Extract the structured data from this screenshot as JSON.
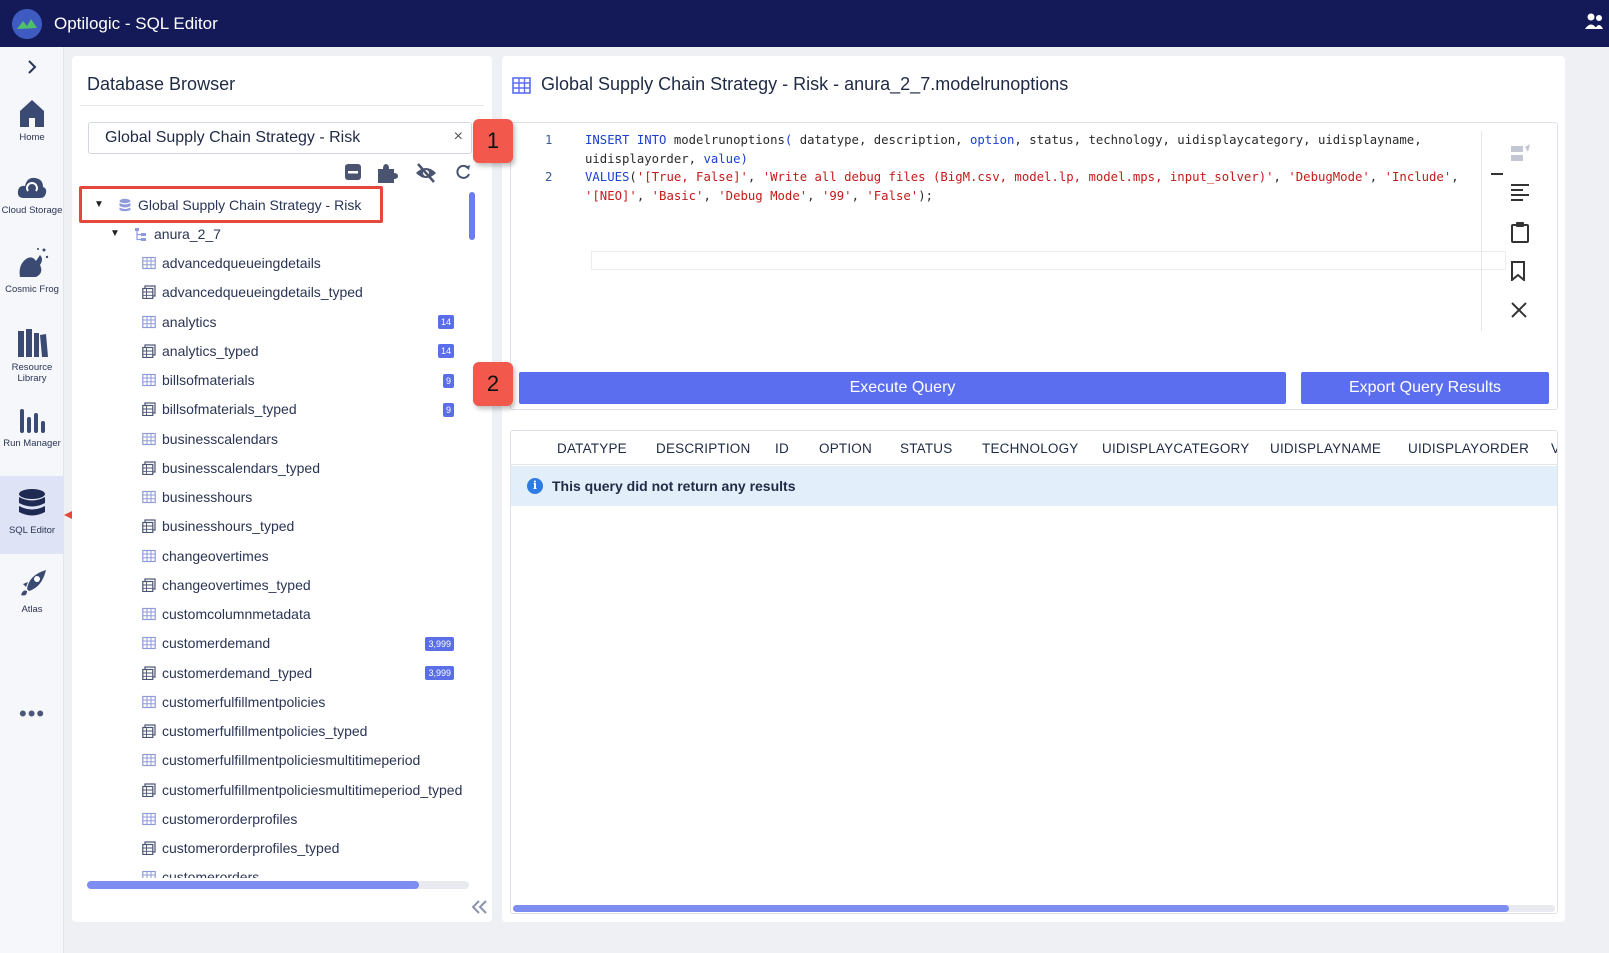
{
  "app": {
    "title": "Optilogic - SQL Editor"
  },
  "rail": {
    "items": [
      {
        "label": "Home",
        "icon": "home-icon"
      },
      {
        "label": "Cloud Storage",
        "icon": "cloud-storage-icon"
      },
      {
        "label": "Cosmic Frog",
        "icon": "cosmic-frog-icon"
      },
      {
        "label": "Resource Library",
        "icon": "resource-library-icon"
      },
      {
        "label": "Run Manager",
        "icon": "run-manager-icon"
      },
      {
        "label": "SQL Editor",
        "icon": "sql-editor-icon",
        "active": true
      },
      {
        "label": "Atlas",
        "icon": "atlas-icon"
      }
    ],
    "more": "•••"
  },
  "browser": {
    "title": "Database Browser",
    "db_select_value": "Global Supply Chain Strategy - Risk",
    "clear": "×",
    "tree": [
      {
        "label": "Global Supply Chain Strategy - Risk",
        "type": "database"
      },
      {
        "label": "anura_2_7",
        "type": "schema"
      },
      {
        "label": "advancedqueueingdetails",
        "type": "table",
        "badge": ""
      },
      {
        "label": "advancedqueueingdetails_typed",
        "type": "view",
        "badge": ""
      },
      {
        "label": "analytics",
        "type": "table",
        "badge": "14"
      },
      {
        "label": "analytics_typed",
        "type": "view",
        "badge": "14"
      },
      {
        "label": "billsofmaterials",
        "type": "table",
        "badge": "9"
      },
      {
        "label": "billsofmaterials_typed",
        "type": "view",
        "badge": "9"
      },
      {
        "label": "businesscalendars",
        "type": "table",
        "badge": ""
      },
      {
        "label": "businesscalendars_typed",
        "type": "view",
        "badge": ""
      },
      {
        "label": "businesshours",
        "type": "table",
        "badge": ""
      },
      {
        "label": "businesshours_typed",
        "type": "view",
        "badge": ""
      },
      {
        "label": "changeovertimes",
        "type": "table",
        "badge": ""
      },
      {
        "label": "changeovertimes_typed",
        "type": "view",
        "badge": ""
      },
      {
        "label": "customcolumnmetadata",
        "type": "table",
        "badge": ""
      },
      {
        "label": "customerdemand",
        "type": "table",
        "badge": "3,999"
      },
      {
        "label": "customerdemand_typed",
        "type": "view",
        "badge": "3,999"
      },
      {
        "label": "customerfulfillmentpolicies",
        "type": "table",
        "badge": ""
      },
      {
        "label": "customerfulfillmentpolicies_typed",
        "type": "view",
        "badge": ""
      },
      {
        "label": "customerfulfillmentpoliciesmultitimeperiod",
        "type": "table",
        "badge": ""
      },
      {
        "label": "customerfulfillmentpoliciesmultitimeperiod_typed",
        "type": "view",
        "badge": ""
      },
      {
        "label": "customerorderprofiles",
        "type": "table",
        "badge": ""
      },
      {
        "label": "customerorderprofiles_typed",
        "type": "view",
        "badge": ""
      },
      {
        "label": "customerorders",
        "type": "table",
        "badge": ""
      }
    ]
  },
  "editor": {
    "title": "Global Supply Chain Strategy - Risk - anura_2_7.modelrunoptions",
    "line_numbers": [
      "1",
      "2"
    ],
    "code_lines": [
      [
        {
          "t": "INSERT INTO",
          "c": "kw"
        },
        {
          "t": " modelrunoptions",
          "c": ""
        },
        {
          "t": "(",
          "c": "kw"
        },
        {
          "t": " datatype, description, ",
          "c": ""
        },
        {
          "t": "option",
          "c": "kw"
        },
        {
          "t": ", status, technology, uidisplaycategory, uidisplayname,",
          "c": ""
        }
      ],
      [
        {
          "t": "uidisplayorder, ",
          "c": ""
        },
        {
          "t": "value",
          "c": "kw"
        },
        {
          "t": ")",
          "c": "kw"
        }
      ],
      [
        {
          "t": "VALUES",
          "c": "kw"
        },
        {
          "t": "(",
          "c": ""
        },
        {
          "t": "'[True, False]'",
          "c": "str"
        },
        {
          "t": ", ",
          "c": ""
        },
        {
          "t": "'Write all debug files (BigM.csv, model.lp, model.mps, input_solver)'",
          "c": "str"
        },
        {
          "t": ", ",
          "c": ""
        },
        {
          "t": "'DebugMode'",
          "c": "str"
        },
        {
          "t": ", ",
          "c": ""
        },
        {
          "t": "'Include'",
          "c": "str"
        },
        {
          "t": ",",
          "c": ""
        }
      ],
      [
        {
          "t": "'[NEO]'",
          "c": "str"
        },
        {
          "t": ", ",
          "c": ""
        },
        {
          "t": "'Basic'",
          "c": "str"
        },
        {
          "t": ", ",
          "c": ""
        },
        {
          "t": "'Debug Mode'",
          "c": "str"
        },
        {
          "t": ", ",
          "c": ""
        },
        {
          "t": "'99'",
          "c": "str"
        },
        {
          "t": ", ",
          "c": ""
        },
        {
          "t": "'False'",
          "c": "str"
        },
        {
          "t": ");",
          "c": ""
        }
      ]
    ],
    "execute_label": "Execute Query",
    "export_label": "Export Query Results"
  },
  "results": {
    "columns": [
      "DATATYPE",
      "DESCRIPTION",
      "ID",
      "OPTION",
      "STATUS",
      "TECHNOLOGY",
      "UIDISPLAYCATEGORY",
      "UIDISPLAYNAME",
      "UIDISPLAYORDER",
      "V"
    ],
    "message": "This query did not return any results",
    "info_glyph": "i"
  },
  "annotations": {
    "callout_1": "1",
    "callout_2": "2"
  },
  "colors": {
    "topbar": "#141a58",
    "accent": "#5b6ef0",
    "annotation": "#e5473b"
  }
}
